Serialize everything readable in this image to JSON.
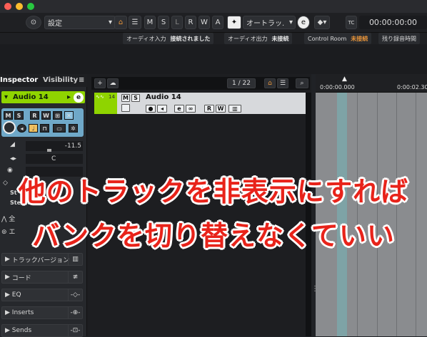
{
  "toolbar": {
    "project_field": "設定",
    "buttons": [
      "M",
      "S",
      "L",
      "R",
      "W",
      "A"
    ],
    "automation_mode": "オートラッ.",
    "timecode": "00:00:00:00",
    "tc_label": "TC"
  },
  "status": {
    "audio_in_label": "オーディオ入力",
    "audio_in_value": "接続されました",
    "audio_out_label": "オーディオ出力",
    "audio_out_value": "未接続",
    "control_room_label": "Control Room",
    "control_room_value": "未接続",
    "remaining_label": "残り録音時間"
  },
  "inspector": {
    "tab_inspector": "Inspector",
    "tab_visibility": "Visibility",
    "track_name": "Audio 14",
    "volume_value": "-11.5",
    "pan_value": "C",
    "routing_in": "St",
    "routing_out": "StereoOut",
    "sections": [
      {
        "label": "トラックバージョン"
      },
      {
        "label": "コード"
      },
      {
        "label": "EQ"
      },
      {
        "label": "Inserts"
      },
      {
        "label": "Sends"
      }
    ],
    "partial_rows": [
      "全",
      "エ"
    ]
  },
  "tracklist": {
    "counter": "1 / 22",
    "track_number": "14",
    "track_name": "Audio 14"
  },
  "ruler": {
    "marks": [
      "0:00:00.000",
      "0:00:02.30"
    ]
  },
  "overlay": {
    "line1": "他のトラックを非表示にすれば",
    "line2": "バンクを切り替えなくていい"
  },
  "colors": {
    "track_green": "#8fd400",
    "accent_orange": "#e8953a",
    "overlay_red": "#e8231a",
    "control_blue": "#6fa8c8"
  }
}
